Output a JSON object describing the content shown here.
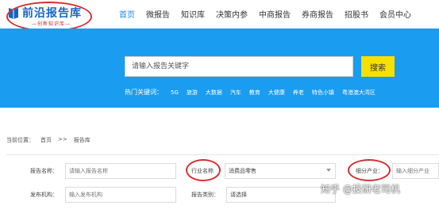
{
  "brand": {
    "title": "前沿报告库",
    "subtitle": "—创新知识库—",
    "accent": "#1565c0",
    "highlight_color": "#d32f2f"
  },
  "nav": {
    "items": [
      "首页",
      "微报告",
      "知识库",
      "决策内参",
      "中商报告",
      "券商报告",
      "招股书",
      "会员中心"
    ],
    "active_index": 0
  },
  "hero": {
    "background": "#1a9cf0",
    "search_placeholder": "请输入报告关键字",
    "search_button": "搜索",
    "hot_label": "热门关键词：",
    "hot_keywords": [
      "5G",
      "旅游",
      "大数据",
      "汽车",
      "教育",
      "大健康",
      "养老",
      "特色小镇",
      "粤港澳大湾区"
    ]
  },
  "breadcrumb": {
    "label": "当前位置：",
    "home": "首页",
    "separator": ">>",
    "current": "报告库"
  },
  "filters": {
    "report_name_label": "报告名称：",
    "report_name_placeholder": "请输入报告名称",
    "industry_label": "行业名称",
    "industry_value": "消费品零售",
    "sub_industry_label": "细分产业：",
    "sub_industry_placeholder": "输入细分产业",
    "publisher_label": "发布机构：",
    "publisher_placeholder": "输入发布机构",
    "category_label": "报告类别：",
    "category_value": "请选择"
  },
  "watermark": "知乎 @投研老司机"
}
